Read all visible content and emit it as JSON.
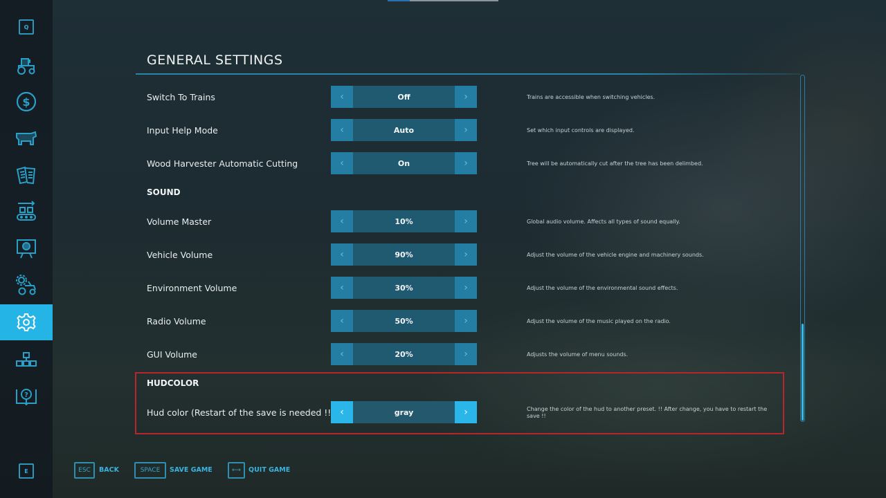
{
  "sidebar": {
    "top_key": "Q",
    "bottom_key": "E",
    "items": [
      {
        "name": "vehicles",
        "icon": "tractor-icon",
        "active": false
      },
      {
        "name": "finances",
        "icon": "dollar-icon",
        "active": false
      },
      {
        "name": "animals",
        "icon": "cow-icon",
        "active": false
      },
      {
        "name": "contracts",
        "icon": "documents-icon",
        "active": false
      },
      {
        "name": "production",
        "icon": "conveyor-icon",
        "active": false
      },
      {
        "name": "statistics",
        "icon": "presentation-icon",
        "active": false
      },
      {
        "name": "garage",
        "icon": "gear-tractor-icon",
        "active": false
      },
      {
        "name": "settings",
        "icon": "gear-icon",
        "active": true
      },
      {
        "name": "multiplayer",
        "icon": "network-icon",
        "active": false
      },
      {
        "name": "help",
        "icon": "help-book-icon",
        "active": false
      }
    ]
  },
  "pager": {
    "active_index": 0
  },
  "page": {
    "title": "GENERAL SETTINGS",
    "rows": [
      {
        "label": "Switch To Trains",
        "value": "Off",
        "desc": "Trains are accessible when switching vehicles."
      },
      {
        "label": "Input Help Mode",
        "value": "Auto",
        "desc": "Set which input controls are displayed."
      },
      {
        "label": "Wood Harvester Automatic Cutting",
        "value": "On",
        "desc": "Tree will be automatically cut after the tree has been delimbed."
      }
    ],
    "sound": {
      "heading": "SOUND",
      "rows": [
        {
          "label": "Volume Master",
          "value": "10%",
          "desc": "Global audio volume. Affects all types of sound equally."
        },
        {
          "label": "Vehicle Volume",
          "value": "90%",
          "desc": "Adjust the volume of the vehicle engine and machinery sounds."
        },
        {
          "label": "Environment Volume",
          "value": "30%",
          "desc": "Adjust the volume of the environmental sound effects."
        },
        {
          "label": "Radio Volume",
          "value": "50%",
          "desc": "Adjust the volume of the music played on the radio."
        },
        {
          "label": "GUI Volume",
          "value": "20%",
          "desc": "Adjusts the volume of menu sounds."
        }
      ]
    },
    "hudcolor": {
      "heading": "HUDCOLOR",
      "row": {
        "label": "Hud color (Restart of the save is needed !!)",
        "value": "gray",
        "desc": "Change the color of the hud to another preset. !! After change, you have to restart the save !!"
      }
    },
    "arrows": {
      "left": "‹",
      "right": "›"
    }
  },
  "footer": {
    "back": {
      "key": "ESC",
      "label": "BACK"
    },
    "save": {
      "key": "SPACE",
      "label": "SAVE GAME"
    },
    "quit": {
      "key": "⟷",
      "label": "QUIT GAME"
    }
  },
  "colors": {
    "accent": "#25b4e6",
    "highlight_border": "#b8262b"
  }
}
